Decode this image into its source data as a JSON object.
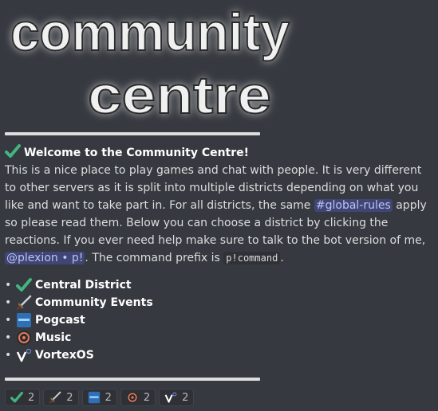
{
  "banner": {
    "line1": "community",
    "line2": "centre"
  },
  "message": {
    "heading": "Welcome to the Community Centre!",
    "p1": "This is a nice place to play games and chat with people. It is very different to other servers as it is split into multiple districts depending on what you like and want to take part in. For all districts, the same ",
    "channel_mention": "#global-rules",
    "p2": " apply so please read them. Below you can choose a district by clicking the reactions.  If you ever need help make sure to talk to the bot version of me, ",
    "user_mention": "@plexion • p!",
    "p3": ". The command prefix is ",
    "prefix_code": "p!command",
    "p4": "."
  },
  "districts": [
    {
      "label": "Central District",
      "icon": "check-mark-icon"
    },
    {
      "label": "Community Events",
      "icon": "sword-icon"
    },
    {
      "label": "Pogcast",
      "icon": "pogcast-icon"
    },
    {
      "label": "Music",
      "icon": "record-icon"
    },
    {
      "label": "VortexOS",
      "icon": "vortexos-icon"
    }
  ],
  "bullet": "•",
  "reactions": [
    {
      "icon": "check-mark-icon",
      "count": "2"
    },
    {
      "icon": "sword-icon",
      "count": "2"
    },
    {
      "icon": "pogcast-icon",
      "count": "2"
    },
    {
      "icon": "record-icon",
      "count": "2"
    },
    {
      "icon": "vortexos-icon",
      "count": "2"
    }
  ],
  "colors": {
    "background": "#36393f",
    "text": "#dcddde",
    "mention": "#b9c3f5",
    "check": "#43b581"
  }
}
